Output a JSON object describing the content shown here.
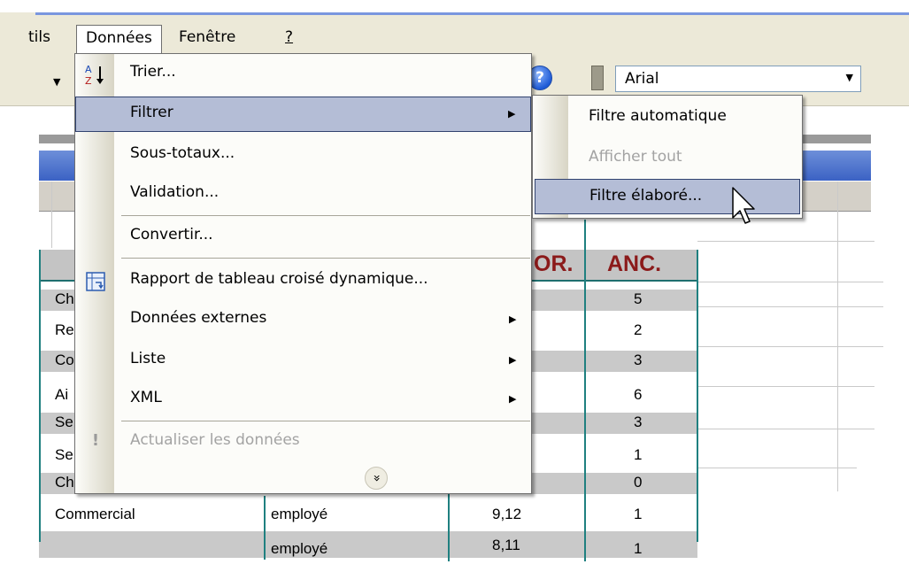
{
  "menubar": {
    "items": [
      {
        "label": "tils"
      },
      {
        "label": "Données"
      },
      {
        "label": "Fenêtre"
      },
      {
        "label": "?"
      }
    ]
  },
  "toolbar": {
    "font_name": "Arial"
  },
  "table": {
    "headers": [
      "OR.",
      "ANC."
    ],
    "rows": [
      {
        "col1": "Ch",
        "col2": "",
        "col3": "",
        "anc": "5"
      },
      {
        "col1": "Re",
        "col2": "",
        "col3": "",
        "anc": "2"
      },
      {
        "col1": "Co",
        "col2": "",
        "col3": "",
        "anc": "3"
      },
      {
        "col1": "Ai",
        "col2": "",
        "col3": "",
        "anc": "6"
      },
      {
        "col1": "Se",
        "col2": "",
        "col3": "",
        "anc": "3"
      },
      {
        "col1": "Se",
        "col2": "",
        "col3": "",
        "anc": "1"
      },
      {
        "col1": "Ch",
        "col2": "",
        "col3": "",
        "anc": "0"
      },
      {
        "col1": "Commercial",
        "col2": "employé",
        "col3": "9,12",
        "anc": "1"
      },
      {
        "col1": "",
        "col2": "employé",
        "col3": "8,11",
        "anc": "1"
      }
    ]
  },
  "donnees_menu": {
    "items": [
      {
        "label": "Trier...",
        "icon": "sort-az-icon"
      },
      {
        "label": "Filtrer",
        "has_submenu": true
      },
      {
        "label": "Sous-totaux..."
      },
      {
        "label": "Validation..."
      },
      {
        "label": "Convertir..."
      },
      {
        "label": "Rapport de tableau croisé dynamique...",
        "icon": "pivot-table-icon"
      },
      {
        "label": "Données externes",
        "has_submenu": true
      },
      {
        "label": "Liste",
        "has_submenu": true
      },
      {
        "label": "XML",
        "has_submenu": true
      },
      {
        "label": "Actualiser les données",
        "disabled": true,
        "icon": "refresh-exclamation-icon"
      }
    ],
    "expand_glyph": "»"
  },
  "filtrer_submenu": {
    "items": [
      {
        "label": "Filtre automatique"
      },
      {
        "label": "Afficher tout",
        "disabled": true
      },
      {
        "label": "Filtre élaboré..."
      }
    ]
  },
  "colors": {
    "menu_highlight": "#b4bdd6",
    "menu_highlight_border": "#31426f",
    "header_text": "#8b1a1a",
    "teal_rule": "#1f8080"
  }
}
